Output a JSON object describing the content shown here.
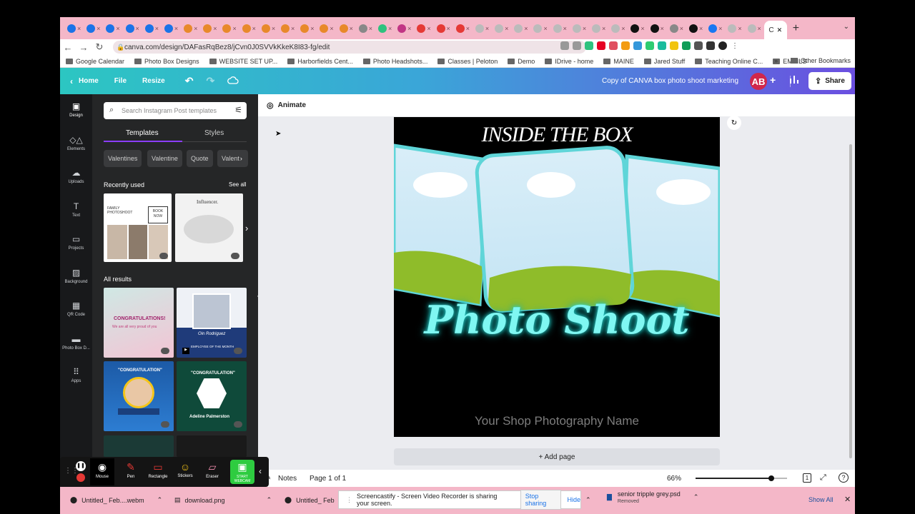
{
  "browser": {
    "tabs_count": 38,
    "active_tab_label": "C",
    "new_tab": "+",
    "url": "canva.com/design/DAFasRqBez8/jCvn0J0SVVkKkeK8I83-fg/edit",
    "bookmarks": [
      "Google Calendar",
      "Photo Box Designs",
      "WEBSITE SET UP...",
      "Harborfields Cent...",
      "Photo Headshots...",
      "Classes | Peloton",
      "Demo",
      "IDrive - home",
      "MAINE",
      "Jared Stuff",
      "Teaching Online C...",
      "EMAILS"
    ],
    "bookmarks_more": "»",
    "other_bookmarks": "Other Bookmarks"
  },
  "header": {
    "home": "Home",
    "file": "File",
    "resize": "Resize",
    "doc_title": "Copy of CANVA box photo shoot marketing",
    "avatar": "AB",
    "plus": "+",
    "share": "Share"
  },
  "rail": [
    {
      "label": "Design",
      "icon": "design-icon"
    },
    {
      "label": "Elements",
      "icon": "elements-icon"
    },
    {
      "label": "Uploads",
      "icon": "uploads-icon"
    },
    {
      "label": "Text",
      "icon": "text-icon"
    },
    {
      "label": "Projects",
      "icon": "projects-icon"
    },
    {
      "label": "Background",
      "icon": "background-icon"
    },
    {
      "label": "QR Code",
      "icon": "qr-icon"
    },
    {
      "label": "Photo Box D...",
      "icon": "photobox-icon"
    },
    {
      "label": "Apps",
      "icon": "apps-icon"
    }
  ],
  "panel": {
    "search_placeholder": "Search Instagram Post templates",
    "tab_templates": "Templates",
    "tab_styles": "Styles",
    "chips": [
      "Valentines",
      "Valentine",
      "Quote",
      "Valent"
    ],
    "recently_used": "Recently used",
    "see_all": "See all",
    "all_results": "All results",
    "thumb1_title": "FAMILY PHOTOSHOOT",
    "thumb1_btn": "BOOK NOW",
    "thumb2_title": "Influencer.",
    "r1_text": "CONGRATULATIONS!",
    "r1_sub": "We are all very proud of you",
    "r2_name": "Oin Rodriguez",
    "r2_sub": "EMPLOYEE OF THE MONTH",
    "r3_text": "\"CONGRATULATION\"",
    "r4_text": "\"CONGRATULATION\"",
    "r4_name": "Adeline Palmerston"
  },
  "tools": [
    {
      "label": "Mouse",
      "icon": "mouse-icon"
    },
    {
      "label": "Pen",
      "icon": "pen-icon"
    },
    {
      "label": "Rectangle",
      "icon": "rectangle-icon"
    },
    {
      "label": "Stickers",
      "icon": "stickers-icon"
    },
    {
      "label": "Eraser",
      "icon": "eraser-icon"
    },
    {
      "label": "START WEBCAM",
      "icon": "webcam-icon"
    }
  ],
  "canvas": {
    "animate": "Animate",
    "title": "INSIDE THE BOX",
    "neon": "Photo Shoot",
    "shop": "Your Shop Photography Name",
    "add_page": "+ Add page"
  },
  "status": {
    "notes": "Notes",
    "page": "Page 1 of 1",
    "zoom": "66%",
    "zoom_level": 0.66,
    "page_num": "1"
  },
  "downloads": {
    "item1": "Untitled_ Feb....webm",
    "item2": "download.png",
    "item3": "Untitled_ Feb",
    "sharing": "Screencastify - Screen Video Recorder is sharing your screen.",
    "stop": "Stop sharing",
    "hide": "Hide",
    "item4": "senior tripple grey.psd",
    "item4_status": "Removed",
    "show_all": "Show All"
  },
  "colors": {
    "accent": "#8b3dff",
    "brand_start": "#2cc6c2",
    "brand_end": "#6b4fe0",
    "neon": "#7ff7f2"
  }
}
